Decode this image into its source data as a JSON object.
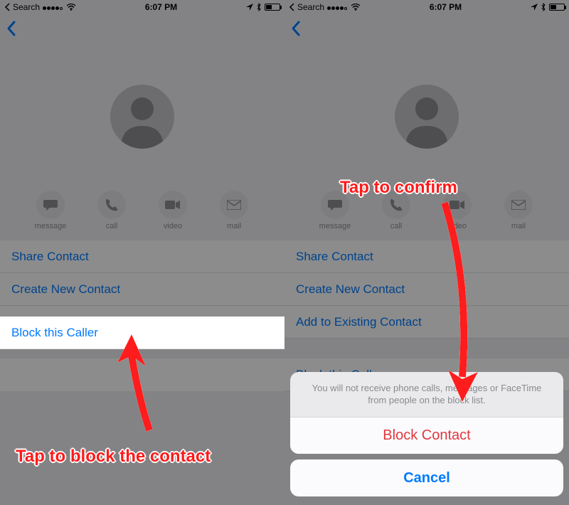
{
  "status": {
    "back_label": "Search",
    "time": "6:07 PM"
  },
  "actions": {
    "message": "message",
    "call": "call",
    "video": "video",
    "mail": "mail"
  },
  "rows": {
    "share": "Share Contact",
    "create": "Create New Contact",
    "add_existing": "Add to Existing Contact",
    "block": "Block this Caller"
  },
  "sheet": {
    "message": "You will not receive phone calls, messages or FaceTime from people on the block list.",
    "block_btn": "Block Contact",
    "cancel": "Cancel"
  },
  "annotations": {
    "left_caption": "Tap to block the contact",
    "right_caption": "Tap to confirm"
  }
}
